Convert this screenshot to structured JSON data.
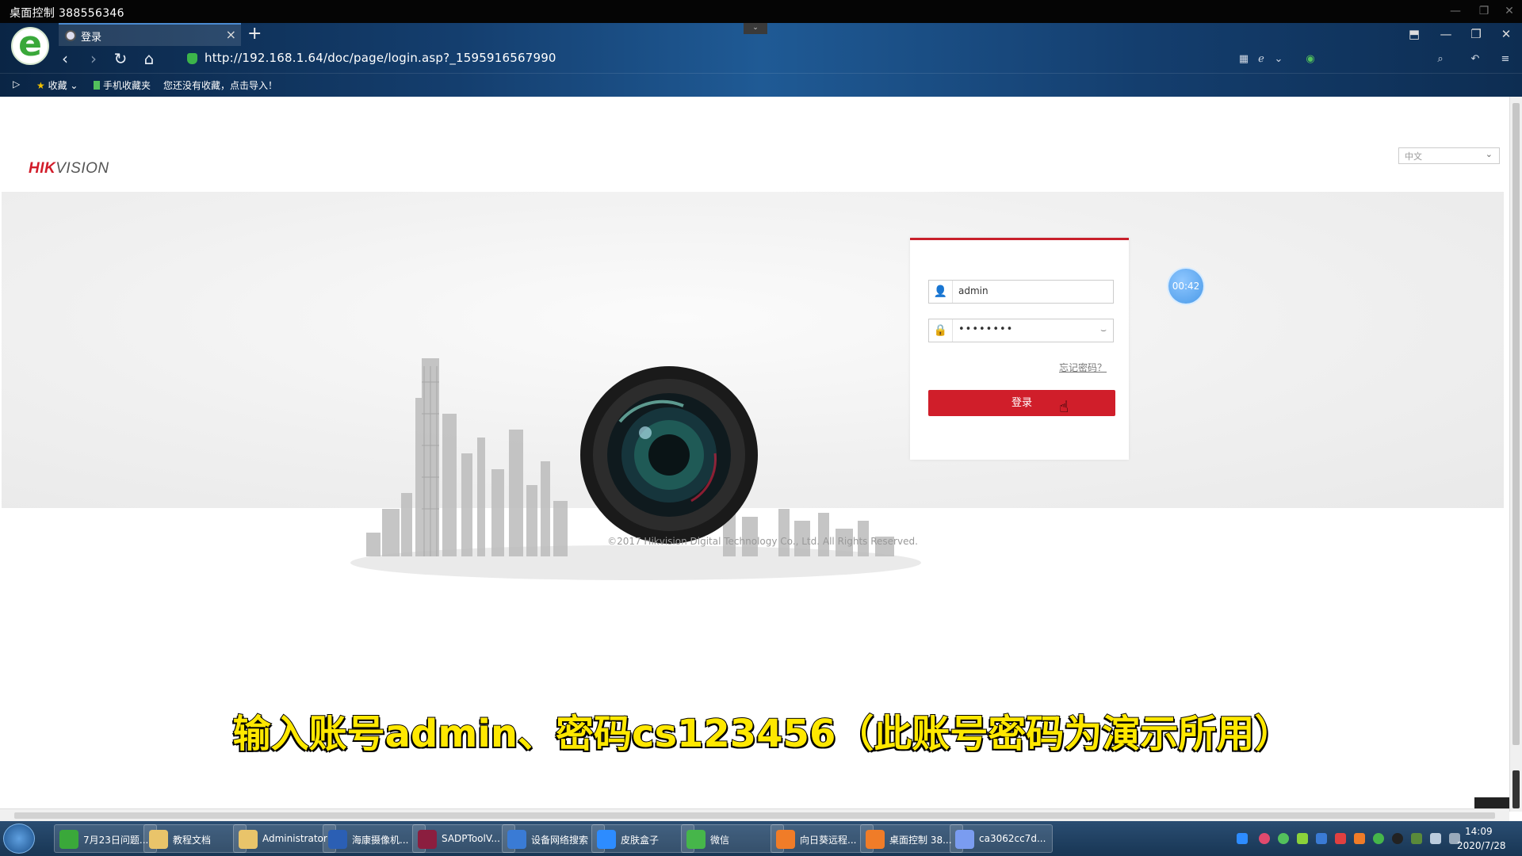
{
  "remote": {
    "title": "桌面控制 388556346"
  },
  "browser": {
    "tab_label": "登录",
    "url": "http://192.168.1.64/doc/page/login.asp?_1595916567990",
    "favorites": {
      "collect": "收藏",
      "mobile": "手机收藏夹",
      "import_hint": "您还没有收藏，点击导入！"
    }
  },
  "page": {
    "logo_red": "HIK",
    "logo_gray": "VISION",
    "language": "中文",
    "login": {
      "username_value": "admin",
      "password_masked": "••••••••",
      "forgot_label": "忘记密码？",
      "login_label": "登录"
    },
    "timer": "00:42",
    "copyright": "©2017 Hikvision Digital Technology Co., Ltd. All Rights Reserved.",
    "caption": "输入账号admin、密码cs123456（此账号密码为演示所用）"
  },
  "taskbar": {
    "items": [
      {
        "label": "7月23日问题...",
        "icon": "browser-icon",
        "color": "#3aa83a"
      },
      {
        "label": "教程文档",
        "icon": "folder-icon",
        "color": "#e9c46a"
      },
      {
        "label": "Administrator",
        "icon": "folder-icon",
        "color": "#e9c46a"
      },
      {
        "label": "海康摄像机...",
        "icon": "word-icon",
        "color": "#2b5fb4"
      },
      {
        "label": "SADPToolV...",
        "icon": "archive-icon",
        "color": "#8b1e3f"
      },
      {
        "label": "设备网络搜索",
        "icon": "globe-icon",
        "color": "#3a7bd5"
      },
      {
        "label": "皮肤盒子",
        "icon": "q-icon",
        "color": "#2d8cff"
      },
      {
        "label": "微信",
        "icon": "wechat-icon",
        "color": "#46b64a"
      },
      {
        "label": "向日葵远程...",
        "icon": "sunflower-icon",
        "color": "#f07c28"
      },
      {
        "label": "桌面控制 38...",
        "icon": "sunflower-icon",
        "color": "#f07c28"
      },
      {
        "label": "ca3062cc7d...",
        "icon": "cloud-icon",
        "color": "#7a9cf0"
      }
    ],
    "time": "14:09",
    "date": "2020/7/28"
  }
}
